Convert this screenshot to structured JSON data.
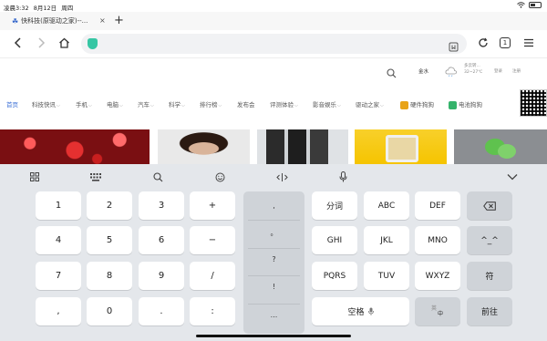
{
  "status_bar": {
    "time": "凌晨3:32",
    "date": "8月12日",
    "weekday": "周四"
  },
  "tab": {
    "title": "快科技(原驱动之家)--...",
    "close_label": "×",
    "new_tab_label": "+"
  },
  "toolbar": {
    "url_value": "",
    "url_placeholder": "",
    "tab_count": "1"
  },
  "site": {
    "city": "金水",
    "weather_desc": "多云转...",
    "weather_temp": "32~27℃",
    "login": "登录",
    "register": "注册",
    "nav": [
      {
        "label": "首页",
        "active": true
      },
      {
        "label": "科技快讯",
        "caret": true
      },
      {
        "label": "手机",
        "caret": true
      },
      {
        "label": "电脑",
        "caret": true
      },
      {
        "label": "汽车",
        "caret": true
      },
      {
        "label": "科学",
        "caret": true
      },
      {
        "label": "排行榜",
        "caret": true
      },
      {
        "label": "发布会"
      },
      {
        "label": "评测体验",
        "caret": true
      },
      {
        "label": "影音娱乐",
        "caret": true
      },
      {
        "label": "驱动之家",
        "caret": true
      },
      {
        "label": "硬件狗狗"
      },
      {
        "label": "电池狗狗"
      }
    ]
  },
  "keyboard": {
    "numpad": [
      [
        "1",
        "2",
        "3",
        "+"
      ],
      [
        "4",
        "5",
        "6",
        "−"
      ],
      [
        "7",
        "8",
        "9",
        "/"
      ],
      [
        ",",
        "0",
        ".",
        ":"
      ]
    ],
    "punct": [
      ",",
      "。",
      "?",
      "!",
      "..."
    ],
    "letters": [
      [
        "分词",
        "ABC",
        "DEF"
      ],
      [
        "GHI",
        "JKL",
        "MNO"
      ],
      [
        "PQRS",
        "TUV",
        "WXYZ"
      ]
    ],
    "emoticon": "^_^",
    "symbol": "符",
    "space": "空格",
    "lang_en": "英",
    "lang_cn": "中",
    "enter": "前往"
  },
  "colors": {
    "accent_blue": "#3b6fd6",
    "shield_green": "#36c6a4",
    "keyboard_bg": "#e4e7eb"
  }
}
